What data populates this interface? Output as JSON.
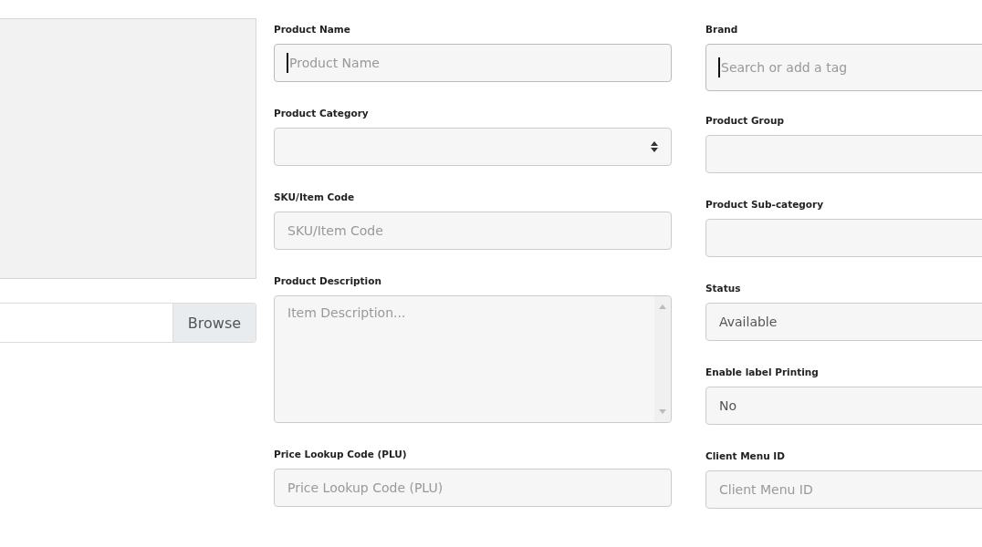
{
  "upload": {
    "button": "Browse"
  },
  "columns": [
    {
      "fields": [
        {
          "label": "Product Name",
          "kind": "text",
          "placeholder": "Product Name",
          "focused": true
        },
        {
          "label": "Product Category",
          "kind": "select"
        },
        {
          "label": "SKU/Item Code",
          "kind": "text",
          "placeholder": "SKU/Item Code",
          "focused": false
        },
        {
          "label": "Product Description",
          "kind": "textarea",
          "placeholder": "Item Description..."
        },
        {
          "label": "Price Lookup Code (PLU)",
          "kind": "text",
          "placeholder": "Price Lookup Code (PLU)",
          "focused": false
        }
      ]
    },
    {
      "fields": [
        {
          "label": "Brand",
          "kind": "tags",
          "placeholder": "Search or add a tag",
          "focused": true
        },
        {
          "label": "Product Group",
          "kind": "text",
          "focused": false
        },
        {
          "label": "Product Sub-category",
          "kind": "text",
          "focused": false
        },
        {
          "label": "Status",
          "kind": "text",
          "value": "Available",
          "focused": false
        },
        {
          "label": "Enable label Printing",
          "kind": "text",
          "value": "No",
          "focused": false
        },
        {
          "label": "Client Menu ID",
          "kind": "text",
          "placeholder": "Client Menu ID",
          "focused": false
        }
      ]
    }
  ]
}
